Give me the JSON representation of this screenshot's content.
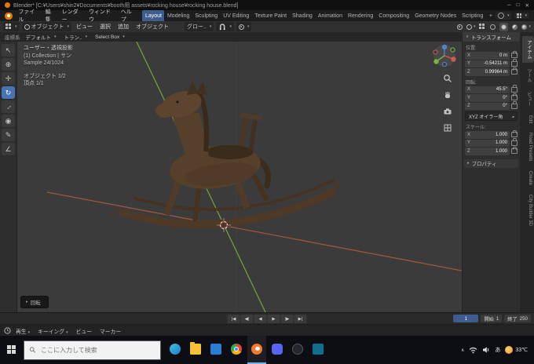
{
  "colors": {
    "accent": "#4772b3",
    "axis_x": "#a85a3c",
    "axis_y": "#7aa83c",
    "viewport_bg": "#3b3b3b",
    "horse_wood": "#55402c"
  },
  "window": {
    "title": "Blender* [C:¥Users¥shin2¥Documents¥booth用 assets¥rocking house¥rocking house.blend]",
    "minimize": "─",
    "maximize": "□",
    "close": "✕"
  },
  "menubar": {
    "menus": [
      "ファイル",
      "編集",
      "レンダー",
      "ウィンドウ",
      "ヘルプ"
    ],
    "workspaces": [
      "Layout",
      "Modeling",
      "Sculpting",
      "UV Editing",
      "Texture Paint",
      "Shading",
      "Animation",
      "Rendering",
      "Compositing",
      "Geometry Nodes",
      "Scripting"
    ],
    "add_workspace": "+",
    "active_workspace": "Layout"
  },
  "viewport_header": {
    "mode": "オブジェクト",
    "menus": [
      "ビュー",
      "選択",
      "追加",
      "オブジェクト"
    ],
    "orientation": "グロー.."
  },
  "tool_settings": {
    "orientation_label": "座標系",
    "orientation_value": "デフォルト",
    "transform_label": "トラン..",
    "tool_value": "Select Box"
  },
  "toolbar": {
    "active_tool": "rotate",
    "tools": [
      {
        "name": "select-box",
        "icon": "↖"
      },
      {
        "name": "cursor",
        "icon": "⊕"
      },
      {
        "name": "move",
        "icon": "✛"
      },
      {
        "name": "rotate",
        "icon": "↻"
      },
      {
        "name": "scale",
        "icon": "↔"
      },
      {
        "name": "transform",
        "icon": "◉"
      },
      {
        "name": "annotate",
        "icon": "✎"
      },
      {
        "name": "measure",
        "icon": "∠"
      }
    ]
  },
  "viewport": {
    "view_label": "ユーザー・透視投影",
    "collection_label": "(1) Collection | サン",
    "sample_label": "Sample 24/1024",
    "stat_objects": "オブジェクト 1/2",
    "stat_vertices": "頂点 1/1",
    "operator_hint": "回転"
  },
  "sidebar": {
    "transform_title": "トランスフォーム",
    "axis_labels": [
      "X",
      "Y",
      "Z"
    ],
    "location_label": "位置:",
    "location": {
      "x": "0 m",
      "y": "-0.54211 m",
      "z": "0.99964 m"
    },
    "rotation_label": "回転:",
    "rotation": {
      "x": "45.5°",
      "y": "0°",
      "z": "0°"
    },
    "rotation_mode": "XYZ オイラー角",
    "scale_label": "スケール:",
    "scale": {
      "x": "1.000",
      "y": "1.000",
      "z": "1.000"
    },
    "properties_label": "プロパティ",
    "tabs": [
      "アイテム",
      "ツール",
      "ビュー",
      "Edit",
      "Road Presets",
      "Create",
      "City Builder 3D"
    ]
  },
  "timeline": {
    "playback": [
      "|◀",
      "◀|",
      "◀",
      "▶",
      "|▶",
      "▶|"
    ],
    "frame_current": "1",
    "start_label": "開始",
    "start_value": "1",
    "end_label": "終了",
    "end_value": "250",
    "menus": [
      "再生",
      "キーイング",
      "ビュー",
      "マーカー"
    ]
  },
  "taskbar": {
    "search_placeholder": "ここに入力して検索",
    "apps": [
      "edge",
      "explorer",
      "mail",
      "chrome",
      "blender",
      "discord",
      "studio",
      "tools"
    ],
    "tray_chevron": "∧",
    "tray_ime": "あ",
    "tray_weather": "33℃"
  }
}
